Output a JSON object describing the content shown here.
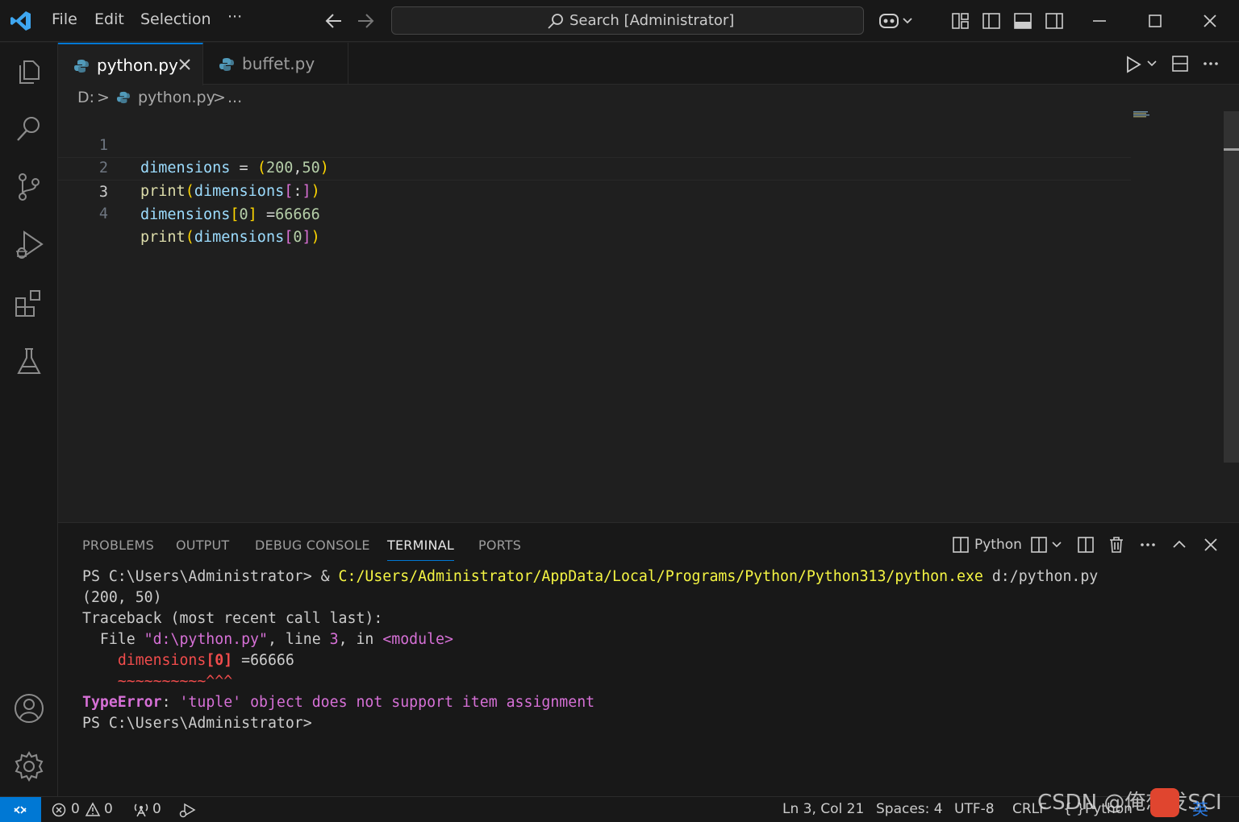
{
  "titlebar": {
    "menus": [
      "File",
      "Edit",
      "Selection",
      "···"
    ],
    "search_placeholder": "Search [Administrator]"
  },
  "tabs": [
    {
      "label": "python.py",
      "active": true
    },
    {
      "label": "buffet.py",
      "active": false
    }
  ],
  "breadcrumb": {
    "drive": "D:",
    "sep": ">",
    "file": "python.py",
    "more": "..."
  },
  "editor": {
    "line_numbers": [
      "1",
      "2",
      "3",
      "4"
    ],
    "current_line": 3,
    "line1": {
      "var": "dimensions",
      "eq": " = ",
      "open": "(",
      "n1": "200",
      "comma": ",",
      "n2": "50",
      "close": ")"
    },
    "line2": {
      "fn": "print",
      "open": "(",
      "var": "dimensions",
      "bopen": "[",
      "slice": ":",
      "bclose": "]",
      "close": ")"
    },
    "line3": {
      "var": "dimensions",
      "bopen": "[",
      "idx": "0",
      "bclose": "]",
      "rest": " =",
      "num": "66666"
    },
    "line4": {
      "fn": "print",
      "open": "(",
      "var": "dimensions",
      "bopen": "[",
      "idx": "0",
      "bclose": "]",
      "close": ")"
    }
  },
  "panel": {
    "tabs": [
      "PROBLEMS",
      "OUTPUT",
      "DEBUG CONSOLE",
      "TERMINAL",
      "PORTS"
    ],
    "active_tab": "TERMINAL",
    "terminal_name": "Python"
  },
  "terminal": {
    "prompt1": "PS C:\\Users\\Administrator> & ",
    "exe": "C:/Users/Administrator/AppData/Local/Programs/Python/Python313/python.exe",
    "arg": " d:/python.py",
    "out1": "(200, 50)",
    "tb_head": "Traceback (most recent call last):",
    "file_pre": "  File ",
    "file_str": "\"d:\\python.py\"",
    "line_word": ", line ",
    "line_no": "3",
    "in_word": ", in ",
    "module": "<module>",
    "code_indent": "    ",
    "code_var": "dimensions",
    "code_idx": "[0]",
    "code_rest": " =66666",
    "carets": "    ~~~~~~~~~~^^^",
    "err_type": "TypeError",
    "err_colon": ": ",
    "err_msg": "'tuple' object does not support item assignment",
    "prompt2": "PS C:\\Users\\Administrator>"
  },
  "status": {
    "errors": "0",
    "warnings": "0",
    "ports": "0",
    "position": "Ln 3, Col 21",
    "spaces": "Spaces: 4",
    "encoding": "UTF-8",
    "eol": "CRLF",
    "braces": "{ }",
    "language": "Python"
  },
  "watermark": "CSDN @俺想发SCI",
  "ime": "英",
  "colors": {
    "accent": "#0078d4",
    "bg_editor": "#1f1f1f",
    "bg_chrome": "#181818",
    "error": "#f14c4c",
    "magenta": "#d670d6",
    "yellow": "#f5f543"
  }
}
